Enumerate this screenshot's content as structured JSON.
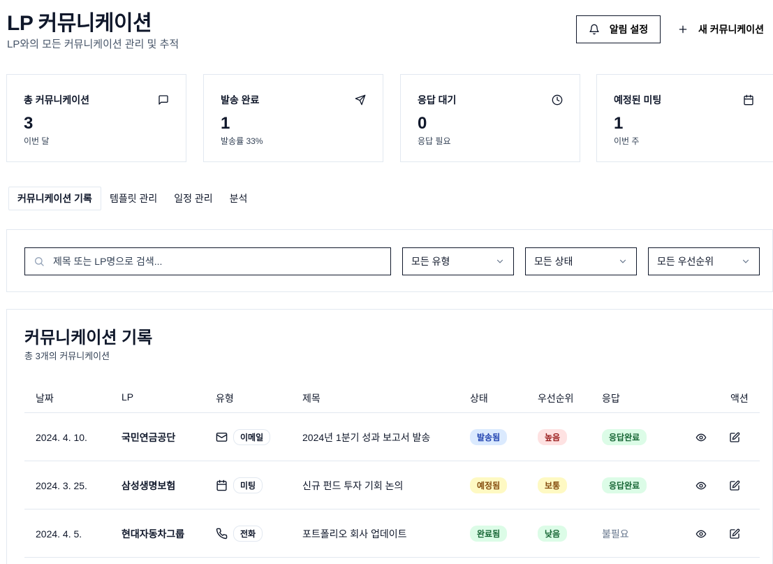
{
  "header": {
    "title": "LP 커뮤니케이션",
    "subtitle": "LP와의 모든 커뮤니케이션 관리 및 추적",
    "alert_button": "알림 설정",
    "new_button": "새 커뮤니케이션"
  },
  "stats": [
    {
      "label": "총 커뮤니케이션",
      "value": "3",
      "sub": "이번 달",
      "icon": "message-square-icon"
    },
    {
      "label": "발송 완료",
      "value": "1",
      "sub": "발송률 33%",
      "icon": "send-icon"
    },
    {
      "label": "응답 대기",
      "value": "0",
      "sub": "응답 필요",
      "icon": "clock-icon"
    },
    {
      "label": "예정된 미팅",
      "value": "1",
      "sub": "이번 주",
      "icon": "calendar-icon"
    }
  ],
  "tabs": [
    "커뮤니케이션 기록",
    "템플릿 관리",
    "일정 관리",
    "분석"
  ],
  "filters": {
    "search_placeholder": "제목 또는 LP명으로 검색...",
    "type": "모든 유형",
    "status": "모든 상태",
    "priority": "모든 우선순위"
  },
  "table": {
    "title": "커뮤니케이션 기록",
    "subtitle": "총 3개의 커뮤니케이션",
    "columns": [
      "날짜",
      "LP",
      "유형",
      "제목",
      "상태",
      "우선순위",
      "응답",
      "액션"
    ],
    "rows": [
      {
        "date": "2024. 4. 10.",
        "lp": "국민연금공단",
        "type": "이메일",
        "type_icon": "mail-icon",
        "title": "2024년 1분기 성과 보고서 발송",
        "status": "발송됨",
        "priority": "높음",
        "response": "응답완료"
      },
      {
        "date": "2024. 3. 25.",
        "lp": "삼성생명보험",
        "type": "미팅",
        "type_icon": "calendar-icon",
        "title": "신규 펀드 투자 기회 논의",
        "status": "예정됨",
        "priority": "보통",
        "response": "응답완료"
      },
      {
        "date": "2024. 4. 5.",
        "lp": "현대자동차그룹",
        "type": "전화",
        "type_icon": "phone-icon",
        "title": "포트폴리오 회사 업데이트",
        "status": "완료됨",
        "priority": "낮음",
        "response": "불필요"
      }
    ]
  },
  "colors": {
    "status_sent_bg": "#dbeafe",
    "status_sent_fg": "#1e40af",
    "status_scheduled_bg": "#fef9c3",
    "status_scheduled_fg": "#854d0e",
    "status_done_bg": "#dcfce7",
    "status_done_fg": "#166534",
    "priority_high_bg": "#fee2e2",
    "priority_high_fg": "#991b1b",
    "priority_mid_bg": "#fef9c3",
    "priority_mid_fg": "#854d0e",
    "priority_low_bg": "#dcfce7",
    "priority_low_fg": "#166534",
    "response_bg": "#dcfce7",
    "response_fg": "#166534"
  }
}
